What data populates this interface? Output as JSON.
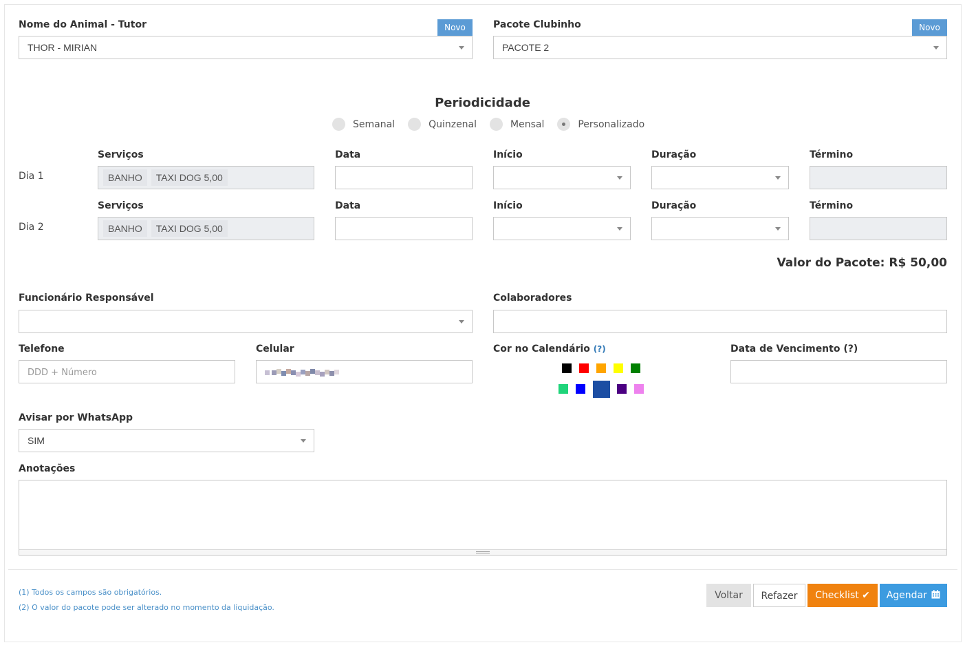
{
  "animal": {
    "label": "Nome do Animal - Tutor",
    "value": "THOR - MIRIAN",
    "novo": "Novo"
  },
  "pacote": {
    "label": "Pacote Clubinho",
    "value": "PACOTE 2",
    "novo": "Novo"
  },
  "periodicidade": {
    "title": "Periodicidade",
    "options": [
      "Semanal",
      "Quinzenal",
      "Mensal",
      "Personalizado"
    ],
    "selected": "Personalizado"
  },
  "dias": [
    {
      "label": "Dia 1",
      "servicos_label": "Serviços",
      "servicos": [
        "BANHO",
        "TAXI DOG 5,00"
      ],
      "data_label": "Data",
      "inicio_label": "Início",
      "duracao_label": "Duração",
      "termino_label": "Término"
    },
    {
      "label": "Dia 2",
      "servicos_label": "Serviços",
      "servicos": [
        "BANHO",
        "TAXI DOG 5,00"
      ],
      "data_label": "Data",
      "inicio_label": "Início",
      "duracao_label": "Duração",
      "termino_label": "Término"
    }
  ],
  "valor_pacote": "Valor do Pacote: R$ 50,00",
  "funcionario": {
    "label": "Funcionário Responsável",
    "value": ""
  },
  "colaboradores": {
    "label": "Colaboradores",
    "value": ""
  },
  "telefone": {
    "label": "Telefone",
    "placeholder": "DDD + Número"
  },
  "celular": {
    "label": "Celular"
  },
  "cor": {
    "label": "Cor no Calendário",
    "help": "(?)",
    "colors_row1": [
      "#000000",
      "#ff0000",
      "#ffa500",
      "#ffff00",
      "#008000"
    ],
    "colors_row2": [
      "#1fd47a",
      "#0000ff",
      "#1c4ea3",
      "#4b0082",
      "#ee82ee"
    ],
    "selected": "#1c4ea3"
  },
  "vencimento": {
    "label": "Data de Vencimento",
    "help": "(?)"
  },
  "whatsapp": {
    "label": "Avisar por WhatsApp",
    "value": "SIM"
  },
  "anotacoes": {
    "label": "Anotações"
  },
  "footnotes": [
    "(1) Todos os campos são obrigatórios.",
    "(2) O valor do pacote pode ser alterado no momento da liquidação."
  ],
  "buttons": {
    "voltar": "Voltar",
    "refazer": "Refazer",
    "checklist": "Checklist ✔",
    "agendar": "Agendar"
  }
}
